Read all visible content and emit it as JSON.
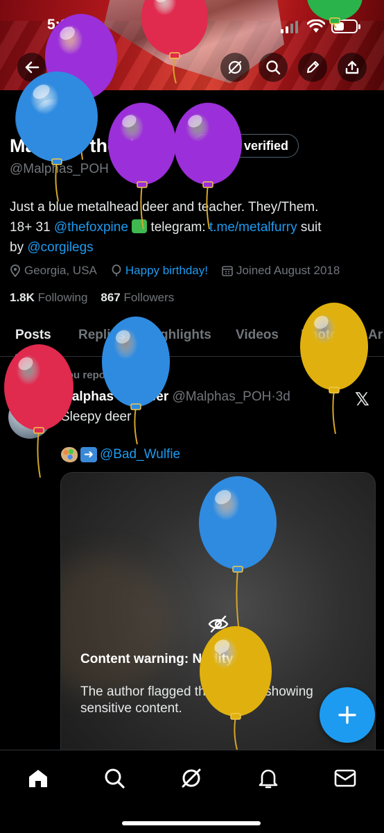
{
  "status_bar": {
    "time": "5:17"
  },
  "profile": {
    "name": "Malphas the deer",
    "get_verified_label": "Get verified",
    "handle": "@Malphas_POH",
    "bio": {
      "line1": "Just a blue metalhead deer and teacher. They/Them.",
      "line2_prefix": "18+ 31 ",
      "mention1": "@thefoxpine",
      "line2_mid": " telegram: ",
      "telegram_link": "t.me/metalfurry",
      "line2_suffix": " suit",
      "line3_prefix": "by ",
      "mention2": "@corgilegs"
    },
    "location": "Georgia, USA",
    "birthday": "Happy birthday!",
    "joined": "Joined August 2018",
    "following_count": "1.8K",
    "following_label": "Following",
    "followers_count": "867",
    "followers_label": "Followers"
  },
  "tabs": [
    {
      "label": "Posts"
    },
    {
      "label": "Replies"
    },
    {
      "label": "Highlights"
    },
    {
      "label": "Videos"
    },
    {
      "label": "Photos"
    },
    {
      "label": "Ar"
    }
  ],
  "post": {
    "reposted_label": "You reposted",
    "author_name": "Malphas the deer",
    "author_handle": "@Malphas_POH",
    "separator": "·",
    "time": "3d",
    "text": "Sleepy deer",
    "credit_mention": "@Bad_Wulfie",
    "content_warning_label": "Content warning:",
    "content_warning_value": "Nudity",
    "content_warning_body": "The author flagged this post as showing sensitive content."
  },
  "colors": {
    "accent": "#1d9bf0",
    "muted": "#71767b",
    "balloon_purple": "#9b2fd9",
    "balloon_blue": "#2f8be0",
    "balloon_red": "#e02a4e",
    "balloon_yellow": "#e0b10e"
  },
  "icons": {
    "back": "arrow-left-icon",
    "grok": "grok-icon",
    "search": "search-icon",
    "edit": "pencil-icon",
    "share": "share-icon",
    "compose": "plus-icon"
  }
}
